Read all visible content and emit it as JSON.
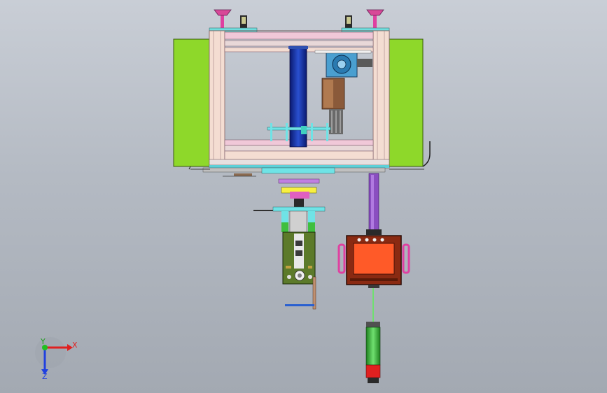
{
  "viewport": {
    "background_top": "#c9ced6",
    "background_bottom": "#a3a9b2"
  },
  "triad": {
    "x_label": "X",
    "y_label": "Y",
    "z_label": "Z",
    "x_color": "#e02020",
    "y_color": "#20c020",
    "z_color": "#2040e0"
  },
  "components": {
    "side_panel_color": "#8ed82a",
    "frame_color": "#f4ddd2",
    "column_color": "#1f3fb0",
    "cyan_color": "#6fe3e6",
    "cabinet_color": "#8a2a12",
    "cabinet_screen_color": "#ff5a28",
    "handle_color": "#e040a0",
    "pcb_color": "#5c7a2a",
    "tower_green": "#3fbf3f",
    "tower_red": "#e02020",
    "rod_color": "#8a4ec0"
  },
  "icons": {
    "gear_motor": "gear-icon",
    "suction_cup": "suction-cup-icon"
  }
}
